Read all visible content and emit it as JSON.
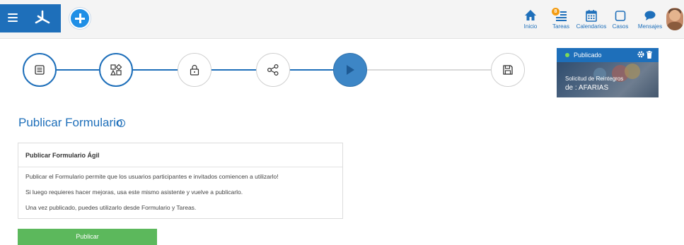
{
  "topbar": {
    "nav": [
      {
        "id": "inicio",
        "label": "Inicio",
        "icon": "home-icon"
      },
      {
        "id": "tareas",
        "label": "Tareas",
        "icon": "tasks-icon",
        "badge": "8"
      },
      {
        "id": "calendarios",
        "label": "Calendarios",
        "icon": "calendar-icon"
      },
      {
        "id": "casos",
        "label": "Casos",
        "icon": "cases-icon"
      },
      {
        "id": "mensajes",
        "label": "Mensajes",
        "icon": "chat-icon"
      }
    ]
  },
  "wizard": {
    "steps": [
      {
        "name": "form-step",
        "state": "done"
      },
      {
        "name": "components-step",
        "state": "done"
      },
      {
        "name": "permissions-step",
        "state": "todo"
      },
      {
        "name": "share-step",
        "state": "todo"
      },
      {
        "name": "publish-step",
        "state": "active"
      },
      {
        "name": "save-step",
        "state": "todo"
      }
    ]
  },
  "card": {
    "status": "Publicado",
    "line1": "Solicitud de Reintegros",
    "line2": "de : AFARIAS"
  },
  "main": {
    "title": "Publicar Formulario",
    "info_icon": "i",
    "panel_title": "Publicar Formulario Ágil",
    "lines": [
      "Publicar el Formulario permite que los usuarios participantes e invitados comiencen a utilizarlo!",
      "Si luego requieres hacer mejoras, usa este mismo asistente y vuelve a publicarlo.",
      "Una vez publicado, puedes utilizarlo desde Formulario y Tareas."
    ],
    "button": "Publicar"
  },
  "colors": {
    "primary": "#1e6fba",
    "active_step": "#3d86c6",
    "publish_button": "#5cb85c",
    "status_dot": "#7ed957"
  }
}
